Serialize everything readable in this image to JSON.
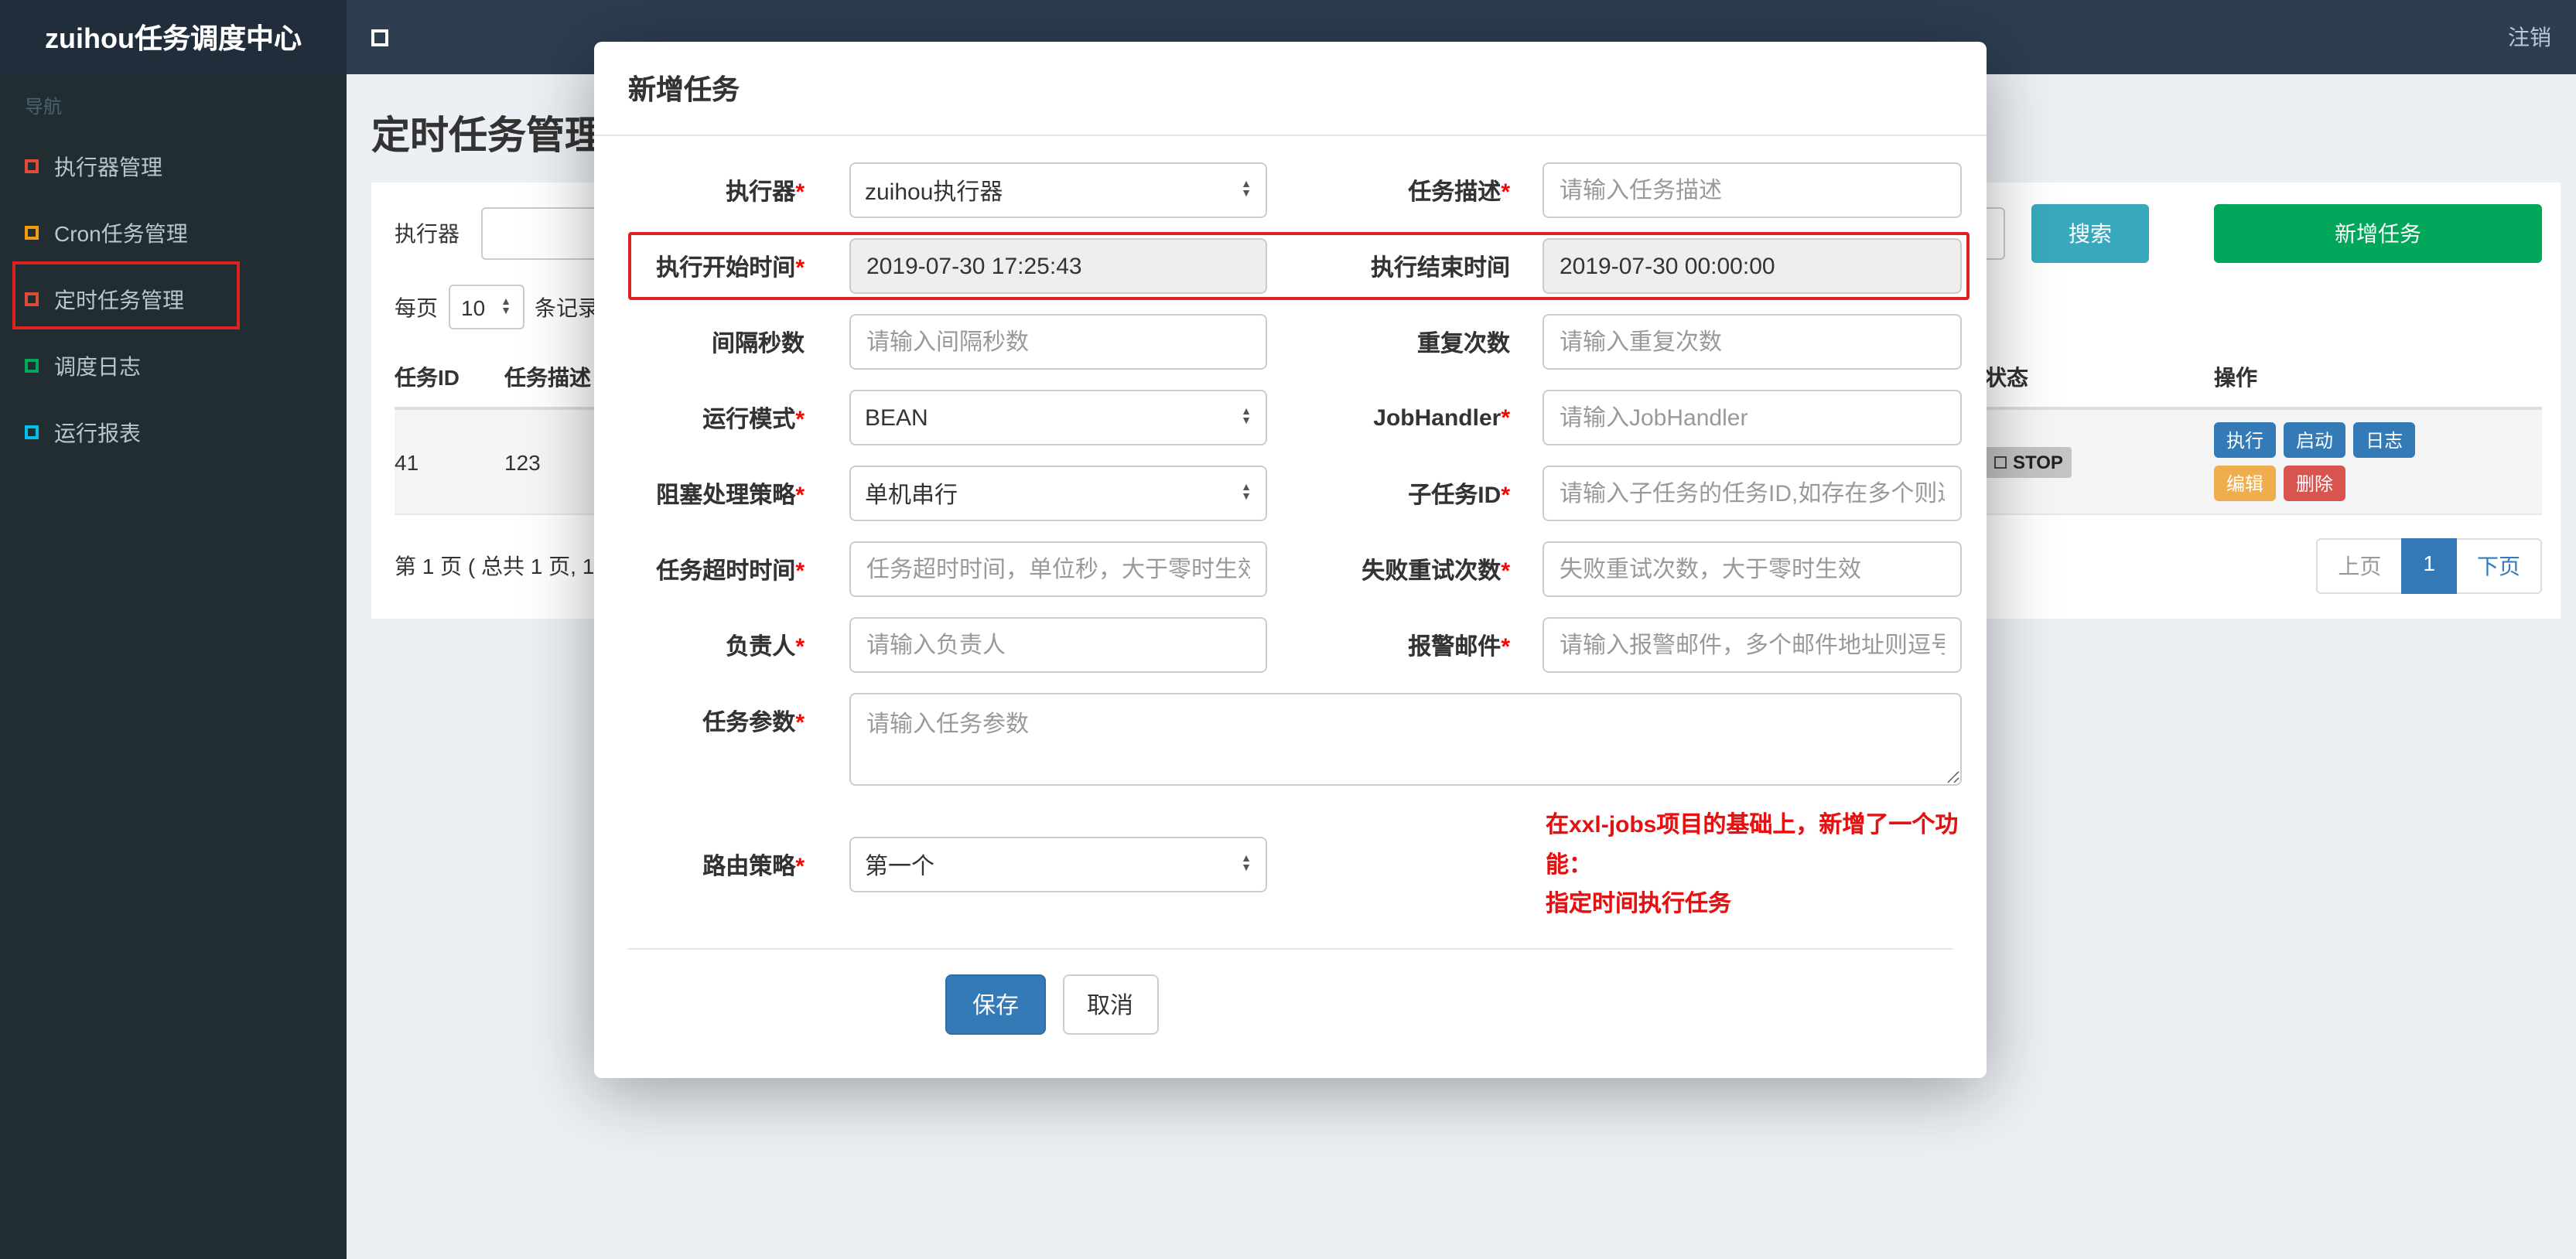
{
  "topbar": {
    "brand": "zuihou任务调度中心",
    "logout": "注销"
  },
  "sidebar": {
    "nav_header": "导航",
    "items": [
      {
        "label": "执行器管理",
        "color": "#dd4b39"
      },
      {
        "label": "Cron任务管理",
        "color": "#f39c12"
      },
      {
        "label": "定时任务管理",
        "color": "#dd4b39"
      },
      {
        "label": "调度日志",
        "color": "#00a65a"
      },
      {
        "label": "运行报表",
        "color": "#00c0ef"
      }
    ]
  },
  "page": {
    "title": "定时任务管理",
    "toolbar": {
      "filter_label": "执行器",
      "search": "搜索",
      "add": "新增任务"
    },
    "perpage": {
      "label": "每页",
      "value": "10",
      "suffix": "条记录"
    },
    "table": {
      "headers": [
        "任务ID",
        "任务描述",
        "状态",
        "操作"
      ],
      "row": {
        "id": "41",
        "desc": "123",
        "status": "STOP",
        "actions": [
          "执行",
          "启动",
          "日志",
          "编辑",
          "删除"
        ]
      }
    },
    "pagination": {
      "info": "第 1 页 ( 总共 1 页, 1",
      "prev": "上页",
      "current": "1",
      "next": "下页"
    }
  },
  "modal": {
    "title": "新增任务",
    "rows": [
      {
        "left": {
          "label": "执行器",
          "req": "*",
          "value": "zuihou执行器"
        },
        "right": {
          "label": "任务描述",
          "req": "*",
          "placeholder": "请输入任务描述"
        }
      },
      {
        "left": {
          "label": "执行开始时间",
          "req": "*",
          "value": "2019-07-30 17:25:43"
        },
        "right": {
          "label": "执行结束时间",
          "req": "",
          "value": "2019-07-30 00:00:00"
        }
      },
      {
        "left": {
          "label": "间隔秒数",
          "req": "",
          "placeholder": "请输入间隔秒数"
        },
        "right": {
          "label": "重复次数",
          "req": "",
          "placeholder": "请输入重复次数"
        }
      },
      {
        "left": {
          "label": "运行模式",
          "req": "*",
          "value": "BEAN"
        },
        "right": {
          "label": "JobHandler",
          "req": "*",
          "placeholder": "请输入JobHandler"
        }
      },
      {
        "left": {
          "label": "阻塞处理策略",
          "req": "*",
          "value": "单机串行"
        },
        "right": {
          "label": "子任务ID",
          "req": "*",
          "placeholder": "请输入子任务的任务ID,如存在多个则逗号分隔"
        }
      },
      {
        "left": {
          "label": "任务超时时间",
          "req": "*",
          "placeholder": "任务超时时间，单位秒，大于零时生效"
        },
        "right": {
          "label": "失败重试次数",
          "req": "*",
          "placeholder": "失败重试次数，大于零时生效"
        }
      },
      {
        "left": {
          "label": "负责人",
          "req": "*",
          "placeholder": "请输入负责人"
        },
        "right": {
          "label": "报警邮件",
          "req": "*",
          "placeholder": "请输入报警邮件，多个邮件地址则逗号分隔"
        }
      }
    ],
    "params": {
      "label": "任务参数",
      "req": "*",
      "placeholder": "请输入任务参数"
    },
    "route": {
      "label": "路由策略",
      "req": "*",
      "value": "第一个"
    },
    "note_line1": "在xxl-jobs项目的基础上，新增了一个功能：",
    "note_line2": "指定时间执行任务",
    "save": "保存",
    "cancel": "取消"
  },
  "colors": {
    "search_teal": "#38a9bd",
    "add_green": "#00a65a",
    "primary_blue": "#337ab7",
    "edit_orange": "#f0ad4e",
    "delete_red": "#d9534f",
    "annotation_red": "#dd2222",
    "status_gray": "#c4c4c4"
  },
  "icons": {
    "sidebar_toggle": "square-outline",
    "status_square": "square-outline",
    "select_arrows": "up-down-triangles"
  }
}
